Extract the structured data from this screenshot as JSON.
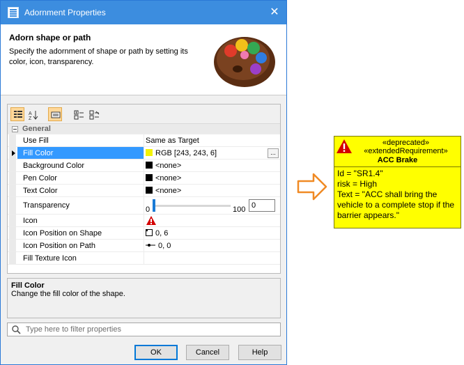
{
  "dialog": {
    "title": "Adornment Properties",
    "close_glyph": "✕",
    "header": {
      "title": "Adorn shape or path",
      "description": "Specify the adornment of shape or path by setting its color, icon, transparency.",
      "illustration": "color-palette-icon"
    },
    "toolbar": {
      "icons": [
        "categorized-view-icon",
        "sort-alphabetical-icon",
        "properties-mode-icon",
        "expand-all-icon",
        "collapse-all-icon"
      ]
    },
    "grid": {
      "category": "General",
      "rows": [
        {
          "name": "Use Fill",
          "value": "Same as Target"
        },
        {
          "name": "Fill Color",
          "value": "RGB [243, 243, 6]",
          "swatch": "#f3f306",
          "selected": true,
          "button": "..."
        },
        {
          "name": "Background Color",
          "value": "<none>",
          "swatch": "#000000"
        },
        {
          "name": "Pen Color",
          "value": "<none>",
          "swatch": "#000000"
        },
        {
          "name": "Text Color",
          "value": "<none>",
          "swatch": "#000000"
        },
        {
          "name": "Transparency",
          "slider_min": "0",
          "slider_max": "100",
          "value": "0",
          "level": 0
        },
        {
          "name": "Icon",
          "icon": "warning-icon"
        },
        {
          "name": "Icon Position on Shape",
          "value": "0, 6",
          "icon": "square-position-icon"
        },
        {
          "name": "Icon Position on Path",
          "value": "0, 0",
          "icon": "path-position-icon"
        },
        {
          "name": "Fill Texture Icon",
          "value": ""
        }
      ]
    },
    "description": {
      "title": "Fill Color",
      "text": "Change the fill color of the shape."
    },
    "filter": {
      "placeholder": "Type here to filter properties"
    },
    "buttons": {
      "ok": "OK",
      "cancel": "Cancel",
      "help": "Help"
    }
  },
  "requirement": {
    "stereotype_1": "«deprecated»",
    "stereotype_2": "«extendedRequirement»",
    "name": "ACC Brake",
    "lines": [
      "Id = \"SR1.4\"",
      "risk = High",
      "Text = \"ACC shall bring the",
      "vehicle to a complete stop if the",
      "barrier appears.\""
    ],
    "fill_color": "#ffff00",
    "icon": "warning-icon"
  },
  "arrow": {
    "icon": "right-arrow-icon",
    "color": "#f08a24"
  }
}
